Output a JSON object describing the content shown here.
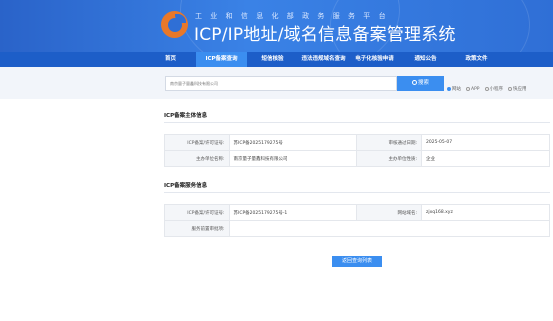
{
  "header": {
    "subtitle": "工业和信息化部政务服务平台",
    "title": "ICP/IP地址/域名信息备案管理系统"
  },
  "nav": {
    "items": [
      {
        "label": "首页",
        "active": false
      },
      {
        "label": "ICP备案查询",
        "active": true
      },
      {
        "label": "短信核验",
        "active": false
      },
      {
        "label": "违法违规域名查询",
        "active": false
      },
      {
        "label": "电子化核验申请",
        "active": false
      },
      {
        "label": "通知公告",
        "active": false
      },
      {
        "label": "政策文件",
        "active": false
      }
    ]
  },
  "search": {
    "value": "南京量子量鑫科技有限公司",
    "button_label": "搜索",
    "types": [
      {
        "label": "网站",
        "checked": true
      },
      {
        "label": "APP",
        "checked": false
      },
      {
        "label": "小程序",
        "checked": false
      },
      {
        "label": "快应用",
        "checked": false
      }
    ]
  },
  "subject_section": {
    "title": "ICP备案主体信息",
    "rows": [
      {
        "label1": "ICP备案/许可证号:",
        "value1": "苏ICP备2025179275号",
        "label2": "审核通过日期:",
        "value2": "2025-05-07"
      },
      {
        "label1": "主办单位名称:",
        "value1": "南京量子量鑫科技有限公司",
        "label2": "主办单位性质:",
        "value2": "企业"
      }
    ]
  },
  "service_section": {
    "title": "ICP备案服务信息",
    "rows": [
      {
        "label1": "ICP备案/许可证号:",
        "value1": "苏ICP备2025179275号-1",
        "label2": "网站域名:",
        "value2": "zjxq168.xyz"
      },
      {
        "label1": "服务前置审批项:",
        "value1": "",
        "label2": "",
        "value2": ""
      }
    ]
  },
  "back_button_label": "返回查询列表",
  "colors": {
    "primary": "#3b8ef0",
    "nav_bg": "#1d5ec8",
    "banner": "#2f6fd6",
    "logo": "#e8782a"
  }
}
